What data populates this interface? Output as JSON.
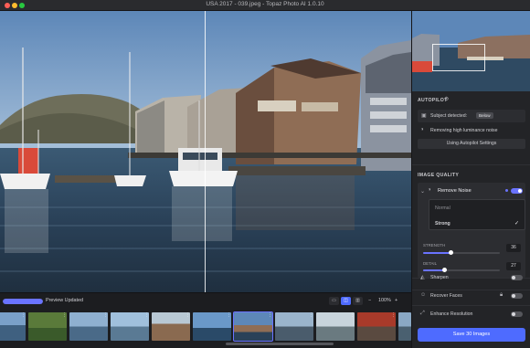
{
  "window": {
    "title": "USA 2017 - 039.jpeg - Topaz Photo AI 1.0.10"
  },
  "colors": {
    "accent": "#6a73ff",
    "save": "#4e6bff",
    "panel": "#232427"
  },
  "autopilot": {
    "header": "AUTOPILOT",
    "subject_label": "Subject detected:",
    "subject_value": "Below",
    "removing_label": "Removing high luminance noise",
    "settings_button": "Using Autopilot Settings"
  },
  "enhancements": {
    "header": "IMAGE QUALITY",
    "remove_noise": {
      "label": "Remove Noise",
      "enabled": true,
      "options": [
        "Normal",
        "Strong"
      ],
      "selected": "Strong",
      "strength_label": "STRENGTH",
      "strength_value": "36",
      "detail_label": "DETAIL",
      "detail_value": "27"
    },
    "sharpen": {
      "label": "Sharpen",
      "enabled": false
    },
    "recover_faces": {
      "label": "Recover Faces",
      "enabled": false
    },
    "enhance_resolution": {
      "label": "Enhance Resolution",
      "enabled": false
    }
  },
  "save_button": "Save 30 Images",
  "bottom": {
    "progress": 1.0,
    "status": "Preview Updated",
    "zoom": "100%"
  },
  "icons": [
    "gear-icon",
    "person-icon",
    "half-circle-icon",
    "chevron-down-icon",
    "checkmark-icon",
    "triangle-icon",
    "face-icon",
    "lock-icon",
    "expand-icon",
    "view-single-icon",
    "view-split-icon",
    "view-sidebyside-icon",
    "zoom-out-icon",
    "zoom-in-icon"
  ]
}
